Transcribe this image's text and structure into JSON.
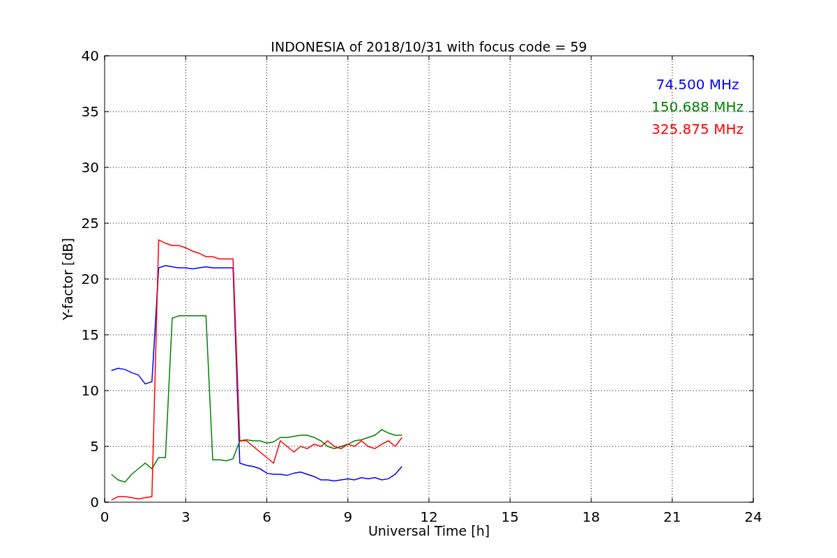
{
  "chart_data": {
    "type": "line",
    "title": "INDONESIA of 2018/10/31 with focus code = 59",
    "xlabel": "Universal Time [h]",
    "ylabel": "Y-factor [dB]",
    "x": [
      0.25,
      0.5,
      0.75,
      1,
      1.25,
      1.5,
      1.75,
      2,
      2.25,
      2.5,
      2.75,
      3,
      3.25,
      3.5,
      3.75,
      4,
      4.25,
      4.5,
      4.75,
      5,
      5.25,
      5.5,
      5.75,
      6,
      6.25,
      6.5,
      6.75,
      7,
      7.25,
      7.5,
      7.75,
      8,
      8.25,
      8.5,
      8.75,
      9,
      9.25,
      9.5,
      9.75,
      10,
      10.25,
      10.5,
      10.75,
      11
    ],
    "series": [
      {
        "name": "74.500 MHz",
        "color": "#0000ff",
        "values": [
          11.8,
          12.0,
          11.9,
          11.6,
          11.4,
          10.6,
          10.8,
          21.0,
          21.2,
          21.1,
          21.0,
          21.0,
          20.9,
          21.0,
          21.1,
          21.0,
          21.0,
          21.0,
          21.0,
          3.5,
          3.3,
          3.2,
          3.0,
          2.6,
          2.5,
          2.5,
          2.4,
          2.6,
          2.7,
          2.5,
          2.3,
          2.0,
          2.0,
          1.9,
          2.0,
          2.1,
          2.0,
          2.2,
          2.1,
          2.2,
          2.0,
          2.1,
          2.5,
          3.2
        ]
      },
      {
        "name": "150.688 MHz",
        "color": "#008000",
        "values": [
          2.5,
          2.0,
          1.8,
          2.5,
          3.0,
          3.5,
          3.0,
          4.0,
          4.0,
          16.5,
          16.7,
          16.7,
          16.7,
          16.7,
          16.7,
          3.8,
          3.8,
          3.7,
          3.9,
          5.5,
          5.6,
          5.5,
          5.5,
          5.3,
          5.4,
          5.8,
          5.8,
          5.9,
          6.0,
          6.0,
          5.8,
          5.5,
          5.0,
          4.8,
          5.0,
          5.2,
          5.5,
          5.6,
          5.8,
          6.0,
          6.5,
          6.2,
          6.0,
          6.0
        ]
      },
      {
        "name": "325.875 MHz",
        "color": "#ff0000",
        "values": [
          0.2,
          0.5,
          0.5,
          0.4,
          0.3,
          0.4,
          0.5,
          23.5,
          23.2,
          23.0,
          23.0,
          22.8,
          22.5,
          22.3,
          22.0,
          22.0,
          21.8,
          21.8,
          21.8,
          5.5,
          5.5,
          5.0,
          4.5,
          4.0,
          3.5,
          5.5,
          5.0,
          4.5,
          5.0,
          4.8,
          5.2,
          5.0,
          5.5,
          5.0,
          4.8,
          5.2,
          5.0,
          5.5,
          5.0,
          4.8,
          5.2,
          5.5,
          5.0,
          5.8
        ]
      }
    ],
    "grid": true,
    "xlim": [
      0,
      24
    ],
    "ylim": [
      0,
      40
    ],
    "xticks": [
      0,
      3,
      6,
      9,
      12,
      15,
      18,
      21,
      24
    ],
    "yticks": [
      0,
      5,
      10,
      15,
      20,
      25,
      30,
      35,
      40
    ]
  }
}
